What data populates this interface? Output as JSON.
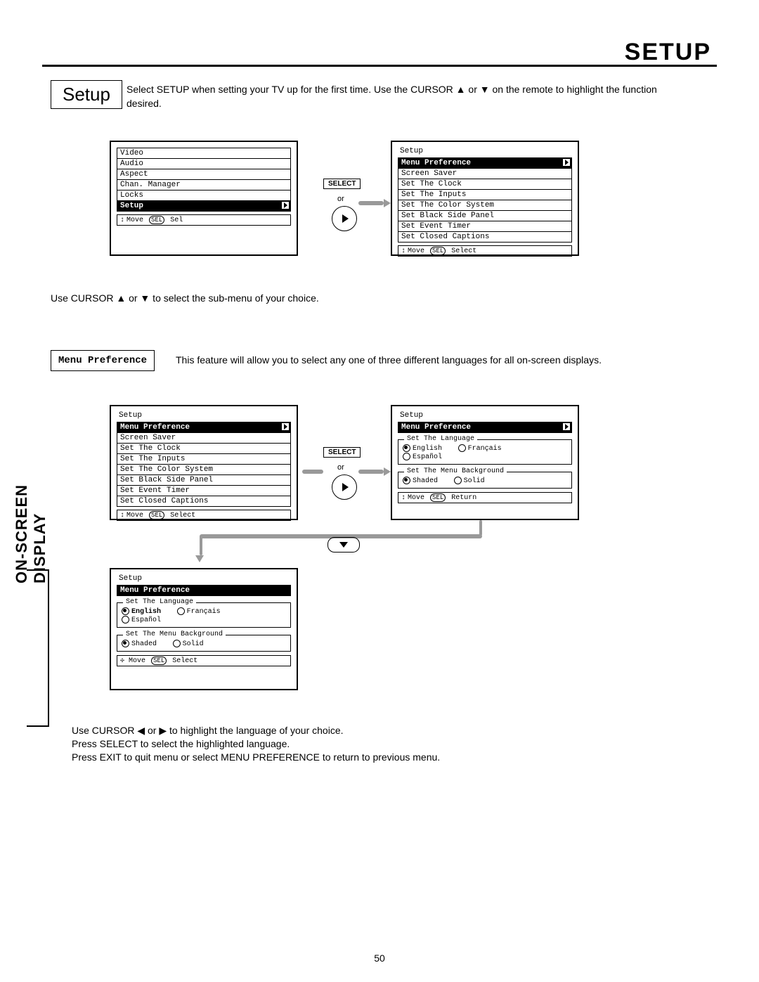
{
  "page": {
    "title": "SETUP",
    "number": "50"
  },
  "sidebar_label": "ON-SCREEN DISPLAY",
  "section": {
    "setup_label": "Setup",
    "intro": "Select SETUP when setting your TV up for the first time.  Use the CURSOR ▲ or ▼ on the remote to highlight the function desired.",
    "instr_submenu": "Use CURSOR ▲ or ▼ to select the sub-menu of your choice.",
    "menu_pref_label": "Menu Preference",
    "menu_pref_desc": "This feature will allow you to select any one of three different languages for all on-screen displays.",
    "instr_lang": "Use CURSOR ◀ or ▶ to highlight the language of your choice.\nPress SELECT to select the highlighted language.\nPress EXIT to quit menu or select MENU PREFERENCE to return to previous menu."
  },
  "connectors": {
    "select": "SELECT",
    "or": "or"
  },
  "osd": {
    "main_menu": {
      "items": [
        "Video",
        "Audio",
        "Aspect",
        "Chan. Manager",
        "Locks",
        "Setup"
      ],
      "selected": "Setup",
      "footer": {
        "move": "Move",
        "action": "Sel",
        "badge": "SEL"
      }
    },
    "setup_menu": {
      "title": "Setup",
      "items": [
        "Menu Preference",
        "Screen Saver",
        "Set The Clock",
        "Set The Inputs",
        "Set The Color System",
        "Set Black Side Panel",
        "Set Event Timer",
        "Set Closed Captions"
      ],
      "selected": "Menu Preference",
      "footer": {
        "move": "Move",
        "action": "Select",
        "badge": "SEL"
      }
    },
    "lang_menu_initial": {
      "title": "Setup",
      "breadcrumb": "Menu Preference",
      "group1": {
        "label": "Set The Language",
        "options": [
          "English",
          "Français",
          "Español"
        ],
        "selected": "English"
      },
      "group2": {
        "label": "Set The Menu Background",
        "options": [
          "Shaded",
          "Solid"
        ],
        "selected": "Shaded"
      },
      "footer": {
        "move": "Move",
        "action": "Return",
        "badge": "SEL"
      }
    },
    "lang_menu_english": {
      "title": "Setup",
      "breadcrumb": "Menu Preference",
      "group1": {
        "label": "Set The Language",
        "options": [
          "English",
          "Français",
          "Español"
        ],
        "selected": "English",
        "bold_selected": true
      },
      "group2": {
        "label": "Set The Menu Background",
        "options": [
          "Shaded",
          "Solid"
        ],
        "selected": "Shaded"
      },
      "footer": {
        "move": "Move",
        "action": "Select",
        "badge": "SEL"
      }
    }
  }
}
